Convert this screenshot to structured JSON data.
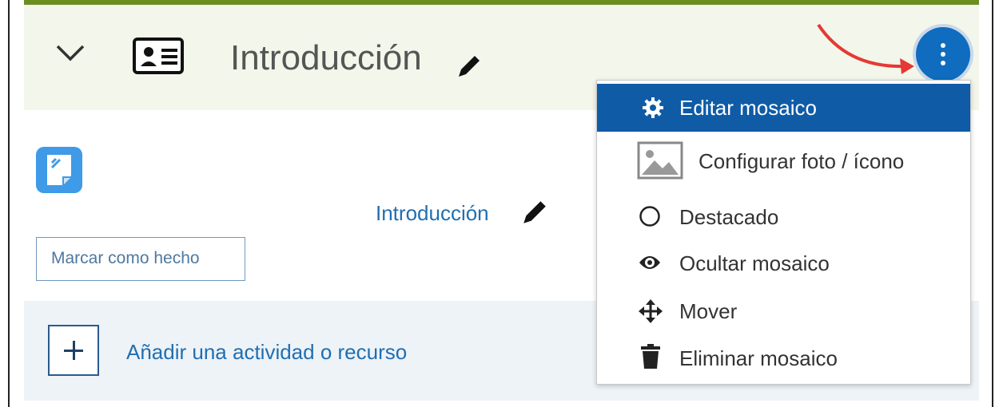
{
  "section": {
    "title": "Introducción"
  },
  "activity": {
    "link_text": "Introducción",
    "done_button": "Marcar como hecho"
  },
  "add_activity": {
    "label": "Añadir una actividad o recurso"
  },
  "menu": {
    "items": [
      {
        "label": "Editar mosaico",
        "icon": "gear-icon"
      },
      {
        "label": "Configurar foto / ícono",
        "icon": "image-icon"
      },
      {
        "label": "Destacado",
        "icon": "circle-icon"
      },
      {
        "label": "Ocultar mosaico",
        "icon": "eye-icon"
      },
      {
        "label": "Mover",
        "icon": "move-icon"
      },
      {
        "label": "Eliminar mosaico",
        "icon": "trash-icon"
      }
    ]
  },
  "colors": {
    "accent": "#0f6cbf",
    "menu_active": "#0f5ba6",
    "header_bg": "#f3f6ea",
    "arrow": "#e53935"
  }
}
